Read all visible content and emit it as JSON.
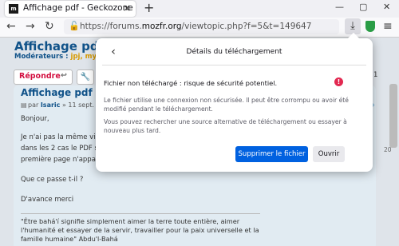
{
  "browser": {
    "tab_title": "Affichage pdf - Geckozone",
    "favicon_text": "m",
    "tab_close": "×",
    "new_tab": "+",
    "url_prefix": "https://forums.",
    "url_domain": "mozfr.org",
    "url_path": "/viewtopic.php?f=5&t=149647"
  },
  "page": {
    "topic_title": "Affichage pdf",
    "moderators_label": "Modérateurs :",
    "moderators_names": "jpj, myal",
    "reply_label": "Répondre",
    "pagination": "sur 1",
    "side_number": "20"
  },
  "post": {
    "title": "Affichage pdf",
    "meta_prefix": "par",
    "author": "Isaric",
    "meta_date": "» 11 sept. 2",
    "lines": [
      "Bonjour,",
      "Je n'ai pas la même visu",
      "dans les 2 cas le PDF s'o",
      "première page n'appara",
      "Que ce passe t-il ?",
      "D'avance merci"
    ],
    "signature": "\"Être bahá'í signifie simplement aimer la terre toute entière, aimer l'humanité et essayer de la servir, travailler pour la paix universelle et la famille humaine\" Abdu'l-Bahá"
  },
  "popup": {
    "title": "Détails du téléchargement",
    "warning_heading": "Fichier non téléchargé : risque de sécurité potentiel.",
    "warning_body": "Le fichier utilise une connexion non sécurisée. Il peut être corrompu ou avoir été modifié pendant le téléchargement.",
    "alternative_body": "Vous pouvez rechercher une source alternative de téléchargement ou essayer à nouveau plus tard.",
    "delete_label": "Supprimer le fichier",
    "open_label": "Ouvrir"
  },
  "colors": {
    "primary_button": "#0061e0",
    "warning": "#e22850",
    "link": "#105289"
  }
}
